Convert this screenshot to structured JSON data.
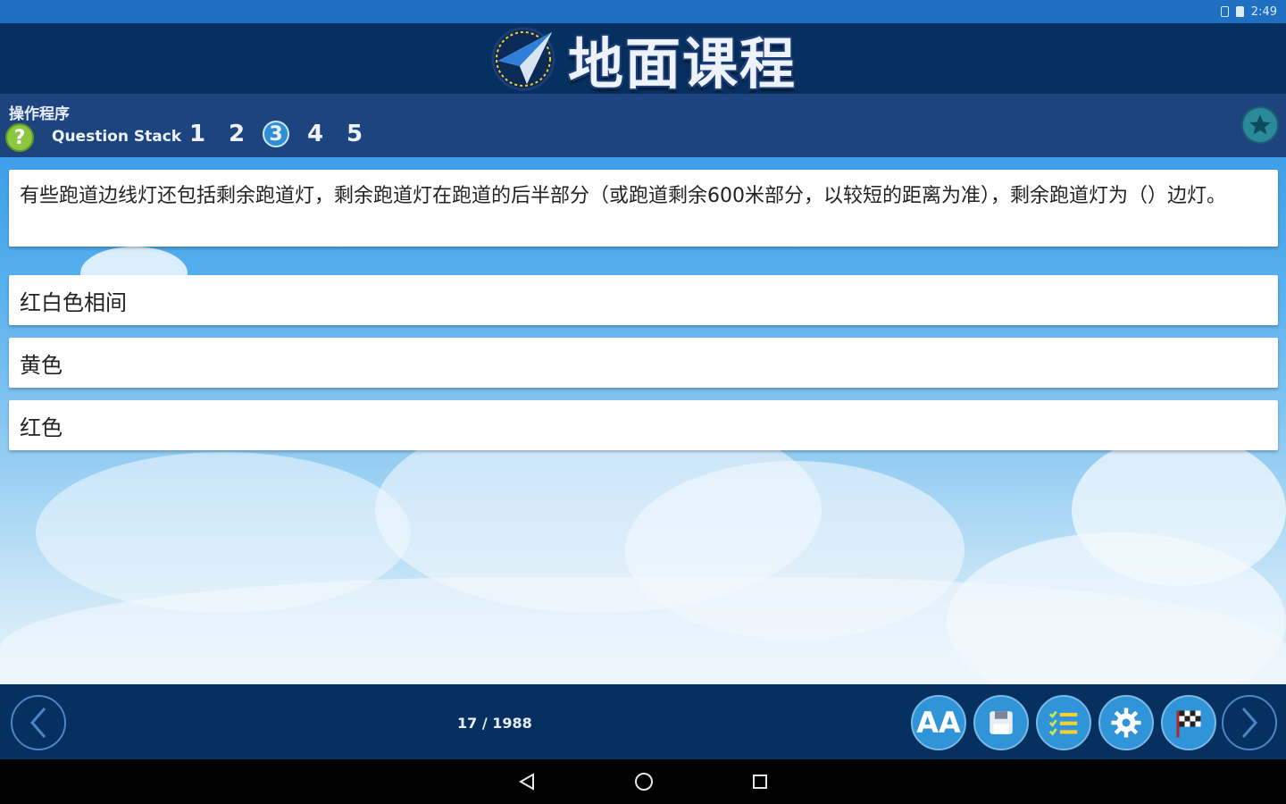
{
  "status_bar": {
    "time": "2:49"
  },
  "header": {
    "title": "地面课程"
  },
  "question_bar": {
    "category": "操作程序",
    "help_label": "?",
    "stack_label": "Question Stack",
    "stack_numbers": [
      "1",
      "2",
      "3",
      "4",
      "5"
    ],
    "active_stack_index": 2
  },
  "question": {
    "text": "有些跑道边线灯还包括剩余跑道灯，剩余跑道灯在跑道的后半部分（或跑道剩余600米部分，以较短的距离为准），剩余跑道灯为（）边灯。"
  },
  "answers": [
    "红白色相间",
    "黄色",
    "红色"
  ],
  "bottom_bar": {
    "counter": "17 / 1988",
    "font_size_label": "AA"
  },
  "colors": {
    "header_bg": "#06305f",
    "question_bar_bg": "#1e4480",
    "tool_button": "#2f94d8",
    "help_icon": "#8dc63f"
  }
}
